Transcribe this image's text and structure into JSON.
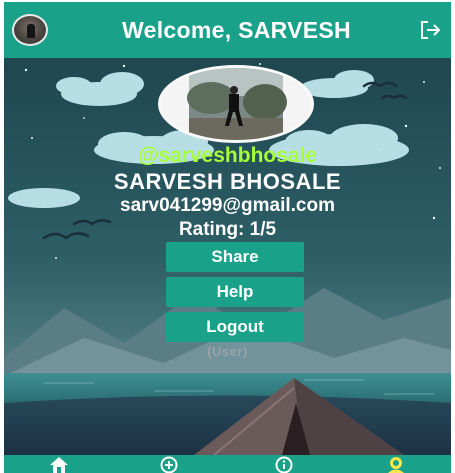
{
  "header": {
    "title": "Welcome, SARVESH",
    "background_color": "#1aa189",
    "left_icon": "avatar-icon",
    "right_icon": "logout-icon"
  },
  "profile": {
    "username": "@sarveshbhosale",
    "full_name": "SARVESH BHOSALE",
    "email": "sarv041299@gmail.com",
    "rating": "Rating: 1/5",
    "role": "(User)",
    "username_color": "#a6ff3a"
  },
  "actions": {
    "share_label": "Share",
    "help_label": "Help",
    "logout_label": "Logout",
    "button_color": "#1aa189"
  },
  "bottom_nav": {
    "items": [
      {
        "icon": "home-icon",
        "active": false
      },
      {
        "icon": "add-circle-icon",
        "active": false
      },
      {
        "icon": "info-icon",
        "active": false
      },
      {
        "icon": "profile-icon",
        "active": true
      }
    ],
    "active_color": "#ffe64d"
  }
}
